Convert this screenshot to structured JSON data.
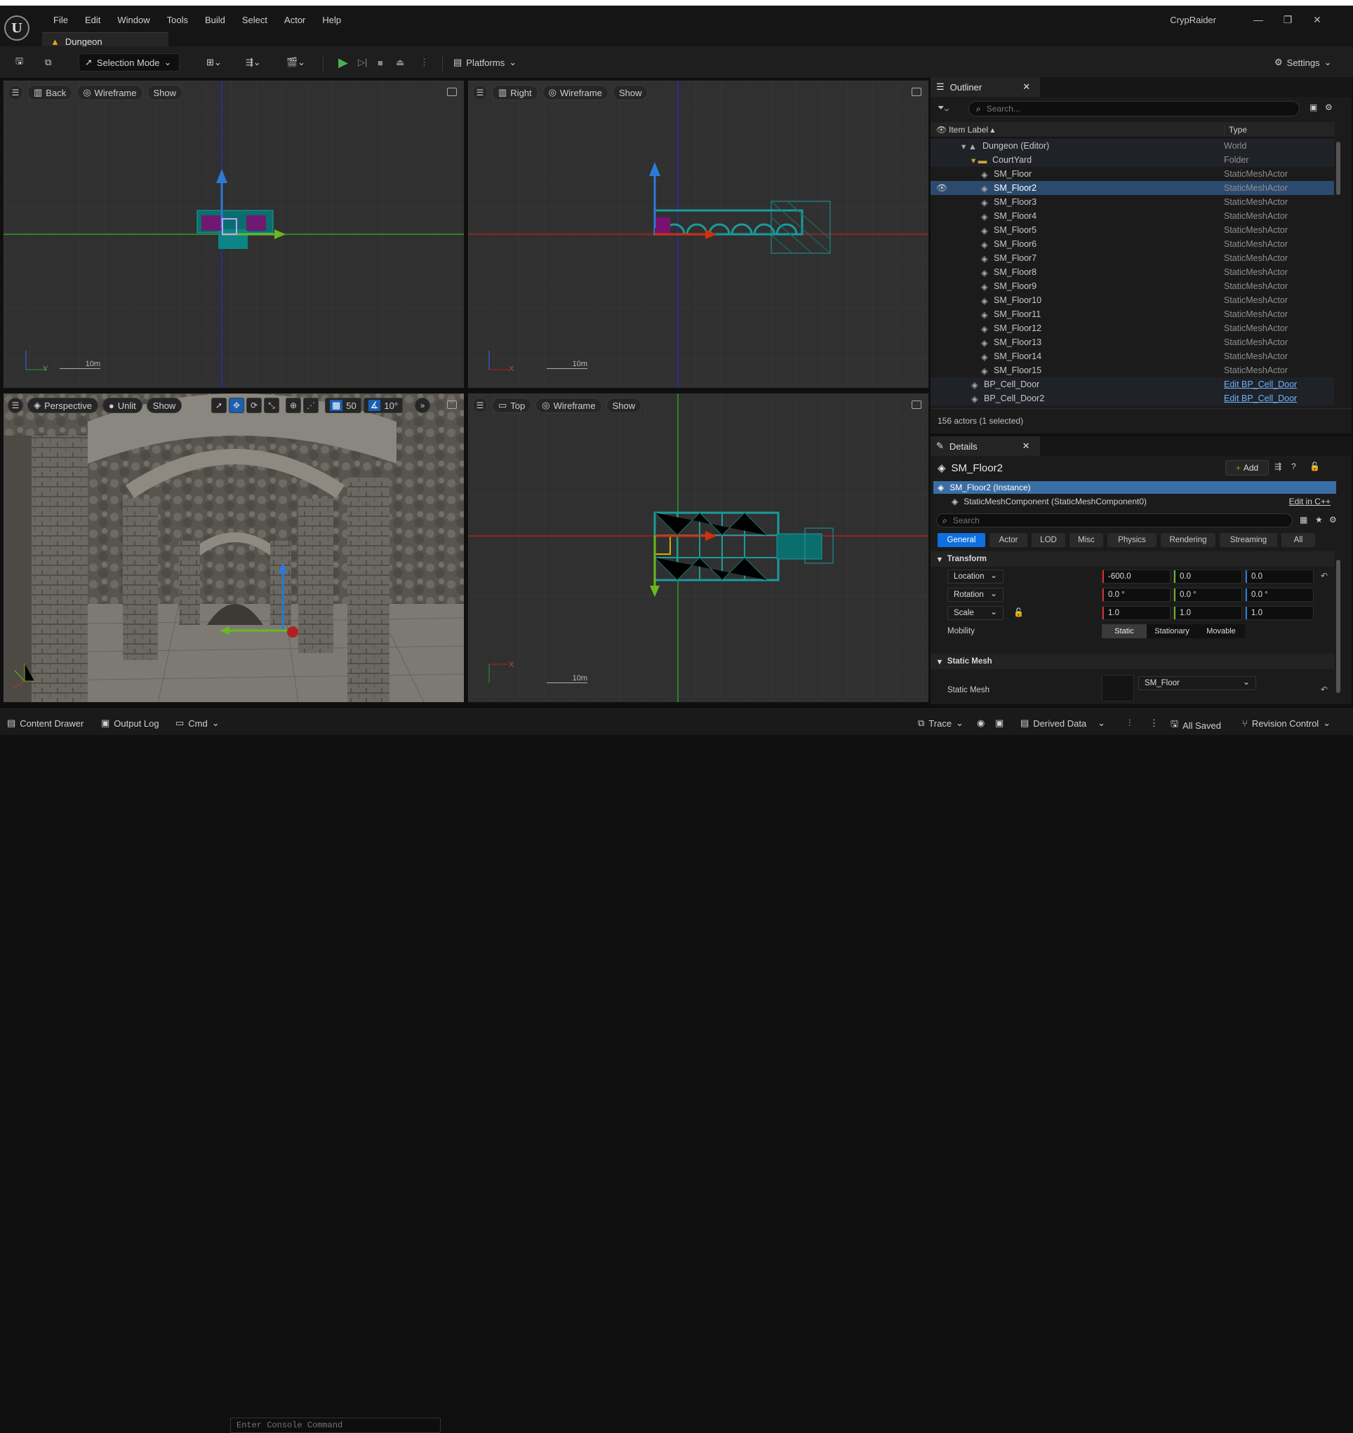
{
  "menu": [
    "File",
    "Edit",
    "Window",
    "Tools",
    "Build",
    "Select",
    "Actor",
    "Help"
  ],
  "tab_title": "Dungeon",
  "app_name": "CrypRaider",
  "toolbar": {
    "selection_mode": "Selection Mode",
    "platforms": "Platforms",
    "settings": "Settings"
  },
  "viewports": {
    "back": {
      "view": "Back",
      "mode": "Wireframe",
      "show": "Show",
      "scale": "10m"
    },
    "right": {
      "view": "Right",
      "mode": "Wireframe",
      "show": "Show",
      "scale": "10m"
    },
    "perspective": {
      "view": "Perspective",
      "mode": "Unlit",
      "show": "Show",
      "grid": "50",
      "angle": "10°"
    },
    "top": {
      "view": "Top",
      "mode": "Wireframe",
      "show": "Show",
      "scale": "10m"
    }
  },
  "outliner": {
    "title": "Outliner",
    "search_placeholder": "Search...",
    "col_label": "Item Label ▴",
    "col_type": "Type",
    "rows": [
      {
        "label": "Dungeon (Editor)",
        "type": "World",
        "indent": 1
      },
      {
        "label": "CourtYard",
        "type": "Folder",
        "indent": 2
      },
      {
        "label": "SM_Floor",
        "type": "StaticMeshActor",
        "indent": 3
      },
      {
        "label": "SM_Floor2",
        "type": "StaticMeshActor",
        "indent": 3,
        "selected": true
      },
      {
        "label": "SM_Floor3",
        "type": "StaticMeshActor",
        "indent": 3
      },
      {
        "label": "SM_Floor4",
        "type": "StaticMeshActor",
        "indent": 3
      },
      {
        "label": "SM_Floor5",
        "type": "StaticMeshActor",
        "indent": 3
      },
      {
        "label": "SM_Floor6",
        "type": "StaticMeshActor",
        "indent": 3
      },
      {
        "label": "SM_Floor7",
        "type": "StaticMeshActor",
        "indent": 3
      },
      {
        "label": "SM_Floor8",
        "type": "StaticMeshActor",
        "indent": 3
      },
      {
        "label": "SM_Floor9",
        "type": "StaticMeshActor",
        "indent": 3
      },
      {
        "label": "SM_Floor10",
        "type": "StaticMeshActor",
        "indent": 3
      },
      {
        "label": "SM_Floor11",
        "type": "StaticMeshActor",
        "indent": 3
      },
      {
        "label": "SM_Floor12",
        "type": "StaticMeshActor",
        "indent": 3
      },
      {
        "label": "SM_Floor13",
        "type": "StaticMeshActor",
        "indent": 3
      },
      {
        "label": "SM_Floor14",
        "type": "StaticMeshActor",
        "indent": 3
      },
      {
        "label": "SM_Floor15",
        "type": "StaticMeshActor",
        "indent": 3
      },
      {
        "label": "BP_Cell_Door",
        "type": "Edit BP_Cell_Door",
        "indent": 2,
        "link": true
      },
      {
        "label": "BP_Cell_Door2",
        "type": "Edit BP_Cell_Door",
        "indent": 2,
        "link": true
      }
    ],
    "footer": "156 actors (1 selected)"
  },
  "details": {
    "title": "Details",
    "actor": "SM_Floor2",
    "add": "Add",
    "instance": "SM_Floor2 (Instance)",
    "component": "StaticMeshComponent (StaticMeshComponent0)",
    "edit_cpp": "Edit in C++",
    "search_placeholder": "Search",
    "categories": [
      "General",
      "Actor",
      "LOD",
      "Misc",
      "Physics",
      "Rendering",
      "Streaming",
      "All"
    ],
    "transform_header": "Transform",
    "location_label": "Location",
    "rotation_label": "Rotation",
    "scale_label": "Scale",
    "location": [
      "-600.0",
      "0.0",
      "0.0"
    ],
    "rotation": [
      "0.0 °",
      "0.0 °",
      "0.0 °"
    ],
    "scale": [
      "1.0",
      "1.0",
      "1.0"
    ],
    "mobility_label": "Mobility",
    "mobility": [
      "Static",
      "Stationary",
      "Movable"
    ],
    "static_mesh_header": "Static Mesh",
    "static_mesh_label": "Static Mesh",
    "static_mesh_value": "SM_Floor"
  },
  "status": {
    "content_drawer": "Content Drawer",
    "output_log": "Output Log",
    "cmd": "Cmd",
    "console_placeholder": "Enter Console Command",
    "trace": "Trace",
    "derived_data": "Derived Data",
    "all_saved": "All Saved",
    "revision_control": "Revision Control"
  }
}
